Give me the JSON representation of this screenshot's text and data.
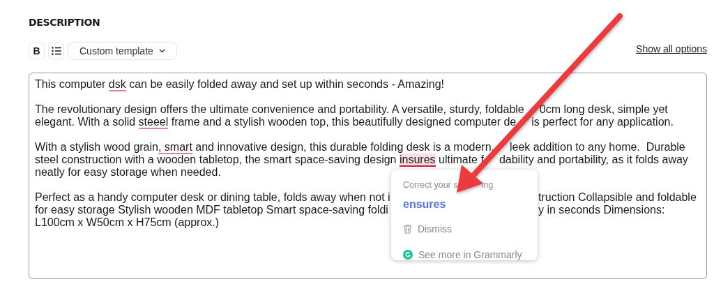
{
  "heading": "DESCRIPTION",
  "toolbar": {
    "bold": "B",
    "template_dropdown": {
      "label": "Custom template"
    },
    "link": "Show all options"
  },
  "editor": {
    "paragraphs": [
      {
        "lines": [
          {
            "segments": [
              {
                "kind": "plain",
                "text": "This computer "
              },
              {
                "kind": "flagged",
                "text": "dsk"
              },
              {
                "kind": "plain",
                "text": " can be easily folded away and set up within seconds - Amazing!"
              }
            ]
          }
        ]
      },
      {
        "lines": [
          {
            "segments": [
              {
                "kind": "plain",
                "text": "The revolutionary design offers the ultimate convenience and portability. A versatile, sturdy, foldable"
              },
              {
                "kind": "after_arrow",
                "text": "0cm long desk, simple yet"
              }
            ]
          },
          {
            "segments": [
              {
                "kind": "plain",
                "text": "elegant. With a solid "
              },
              {
                "kind": "flagged",
                "text": "steeel"
              },
              {
                "kind": "plain",
                "text": " frame and a stylish wooden top, this beautifully designed computer de"
              },
              {
                "kind": "after_arrow",
                "text": "is perfect for any application."
              }
            ]
          }
        ]
      },
      {
        "lines": [
          {
            "segments": [
              {
                "kind": "plain",
                "text": "With a stylish wood grain"
              },
              {
                "kind": "flagged",
                "text": ", smart"
              },
              {
                "kind": "plain",
                "text": " and innovative design, this durable folding desk is a modern,"
              },
              {
                "kind": "after_arrow",
                "text": "leek addition to any home.  Durable"
              }
            ]
          },
          {
            "segments": [
              {
                "kind": "plain",
                "text": "steel construction with a wooden tabletop, the smart space-saving design "
              },
              {
                "kind": "active",
                "text": "insures"
              },
              {
                "kind": "plain",
                "text": " ultimate f"
              },
              {
                "kind": "after_arrow",
                "text": "dability and portability, as it folds away"
              }
            ]
          },
          {
            "segments": [
              {
                "kind": "plain",
                "text": "neatly for easy storage when needed."
              }
            ]
          }
        ]
      },
      {
        "lines": [
          {
            "segments": [
              {
                "kind": "plain",
                "text": "Perfect as a handy computer desk or dining table, folds away when not i"
              }
            ],
            "right_segments": [
              {
                "kind": "plain",
                "text": "truction Collapsible and foldable"
              }
            ]
          },
          {
            "segments": [
              {
                "kind": "plain",
                "text": "for easy storage Stylish wooden MDF tabletop Smart space-saving foldi"
              }
            ],
            "right_segments": [
              {
                "kind": "plain",
                "text": "y in seconds Dimensions:"
              }
            ]
          },
          {
            "segments": [
              {
                "kind": "plain",
                "text": "L100cm x W50cm x H75cm (approx.)"
              }
            ]
          }
        ]
      }
    ]
  },
  "suggestion_popup": {
    "title_parts": [
      "Correct your s",
      "ing"
    ],
    "suggestion": "ensures",
    "dismiss": "Dismiss",
    "more": "See more in Grammarly"
  }
}
